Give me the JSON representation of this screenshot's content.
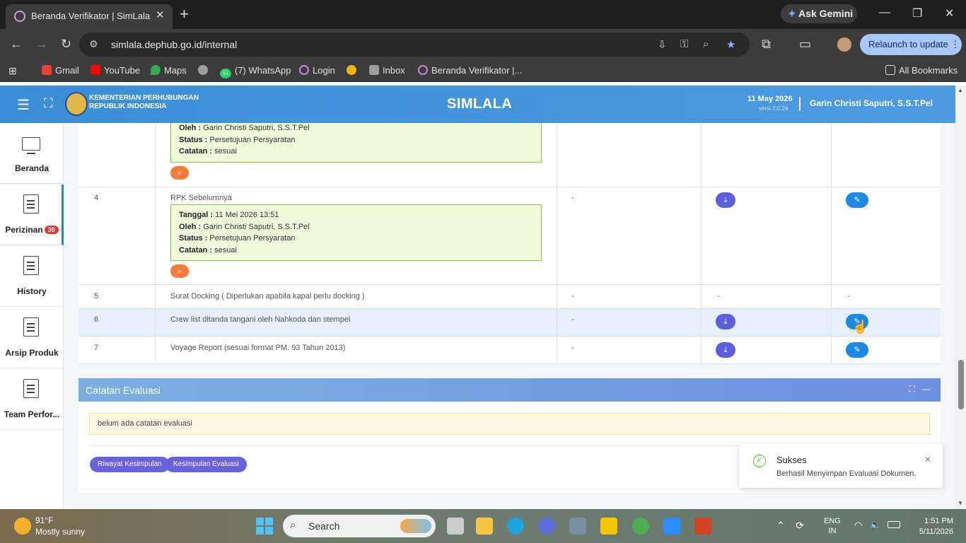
{
  "browser": {
    "tab_title": "Beranda Verifikator | SimLala",
    "ask_gemini": "Ask Gemini",
    "url_domain": "simlala.dephub.go.id",
    "url_path": "/internal",
    "relaunch_label": "Relaunch to update",
    "bookmarks": [
      {
        "label": "Gmail",
        "color": "#ea4335"
      },
      {
        "label": "YouTube",
        "color": "#ff0000"
      },
      {
        "label": "Maps",
        "color": "#34a853"
      },
      {
        "label": "",
        "color": "#9e9e9e"
      },
      {
        "label": "(7) WhatsApp",
        "color": "#25d366"
      },
      {
        "label": "Login",
        "color": "#c08cd0"
      },
      {
        "label": "",
        "color": "#f4b400"
      },
      {
        "label": "Inbox",
        "color": "#9e9e9e"
      },
      {
        "label": "Beranda Verifikator |...",
        "color": "#c08cd0"
      }
    ],
    "all_bookmarks": "All Bookmarks",
    "whatsapp_badge": "51"
  },
  "header": {
    "ministry_line1": "KEMENTERIAN PERHUBUNGAN",
    "ministry_line2": "REPUBLIK INDONESIA",
    "app_title": "SIMLALA",
    "date": "11 May 2026",
    "version": "versi 2.0.24",
    "user": "Garin Christi Saputri, S.S.T.Pel"
  },
  "sidebar": {
    "items": [
      {
        "label": "Beranda",
        "icon": "monitor-icon"
      },
      {
        "label": "Perizinan",
        "icon": "document-icon",
        "badge": "30"
      },
      {
        "label": "History",
        "icon": "document-icon"
      },
      {
        "label": "Arsip Produk",
        "icon": "document-icon"
      },
      {
        "label": "Team Perfor...",
        "icon": "document-icon"
      }
    ]
  },
  "table": {
    "top_note": {
      "oleh_label": "Oleh :",
      "oleh": "Garin Christi Saputri, S.S.T.Pel",
      "status_label": "Status :",
      "status": "Persetujuan Persyaratan",
      "catatan_label": "Catatan :",
      "catatan": "sesuai"
    },
    "rows": [
      {
        "no": "4",
        "name": "RPK Sebelumnya",
        "col3": "-",
        "note": {
          "tanggal_label": "Tanggal :",
          "tanggal": "11 Mei 2026 13:51",
          "oleh_label": "Oleh :",
          "oleh": "Garin Christi Saputri, S.S.T.Pel",
          "status_label": "Status :",
          "status": "Persetujuan Persyaratan",
          "catatan_label": "Catatan :",
          "catatan": "sesuai"
        }
      },
      {
        "no": "5",
        "name": "Surat Docking ( Diperlukan apabila kapal perlu docking )",
        "col3": "-",
        "col4": "-",
        "col5": "-"
      },
      {
        "no": "6",
        "name": "Crew list ditanda tangani oleh Nahkoda dan stempel",
        "col3": "-"
      },
      {
        "no": "7",
        "name": "Voyage Report (sesuai format PM. 93 Tahun 2013)",
        "col3": "-"
      }
    ]
  },
  "evaluasi": {
    "title": "Catatan Evaluasi",
    "note": "belum ada catatan evaluasi",
    "btn_riwayat": "Riwayat Kesimpulan",
    "btn_kesimpulan": "Kesimpulan Evaluasi"
  },
  "toast": {
    "title": "Sukses",
    "message": "Berhasil Menyimpan Evaluasi Dokumen."
  },
  "taskbar": {
    "temperature": "91°F",
    "condition": "Mostly sunny",
    "search_placeholder": "Search",
    "lang_line1": "ENG",
    "lang_line2": "IN",
    "time": "1:51 PM",
    "date": "5/11/2026"
  }
}
